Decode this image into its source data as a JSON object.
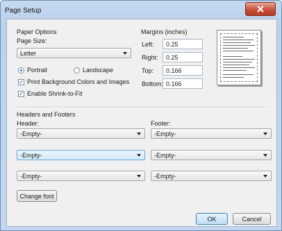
{
  "window": {
    "title": "Page Setup",
    "close_icon": "close-icon",
    "accent": "#c8513c"
  },
  "paper_options": {
    "heading": "Paper Options",
    "size_label": "Page Size:",
    "size_value": "Letter",
    "portrait_label": "Portrait",
    "landscape_label": "Landscape",
    "orientation_selected": "Portrait",
    "print_bg_label": "Print Background Colors and Images",
    "print_bg_checked": true,
    "shrink_label": "Enable Shrink-to-Fit",
    "shrink_checked": true
  },
  "margins": {
    "heading": "Margins (inches)",
    "left_label": "Left:",
    "left_value": "0.25",
    "right_label": "Right:",
    "right_value": "0.25",
    "top_label": "Top:",
    "top_value": "0.166",
    "bottom_label": "Bottom:",
    "bottom_value": "0.166"
  },
  "headers_footers": {
    "heading": "Headers and Footers",
    "header_label": "Header:",
    "footer_label": "Footer:",
    "header_values": [
      "-Empty-",
      "-Empty-",
      "-Empty-"
    ],
    "footer_values": [
      "-Empty-",
      "-Empty-",
      "-Empty-"
    ]
  },
  "buttons": {
    "change_font": "Change font",
    "ok": "OK",
    "cancel": "Cancel"
  }
}
